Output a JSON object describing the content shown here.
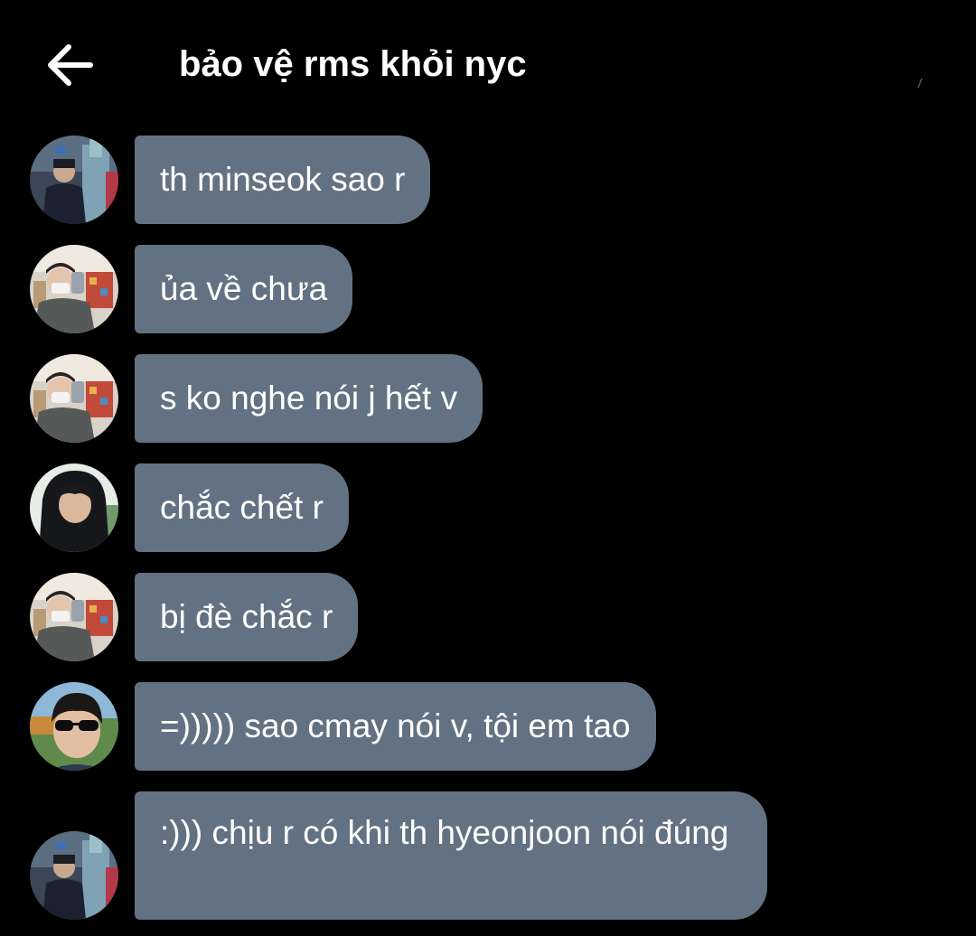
{
  "header": {
    "back_icon": "arrow-left-icon",
    "title": "bảo vệ rms khỏi nyc"
  },
  "colors": {
    "background": "#000000",
    "bubble": "#637282",
    "text": "#ffffff"
  },
  "messages": [
    {
      "avatar": "avatar-a",
      "text": "th minseok sao r"
    },
    {
      "avatar": "avatar-b",
      "text": "ủa về chưa"
    },
    {
      "avatar": "avatar-b",
      "text": "s ko nghe nói j hết v"
    },
    {
      "avatar": "avatar-c",
      "text": "chắc chết r"
    },
    {
      "avatar": "avatar-b",
      "text": "bị đè chắc r"
    },
    {
      "avatar": "avatar-d",
      "text": "=))))) sao cmay nói v, tội em tao"
    },
    {
      "avatar": "avatar-a",
      "text": ":))) chịu r có khi th hyeonjoon nói đúng"
    }
  ]
}
